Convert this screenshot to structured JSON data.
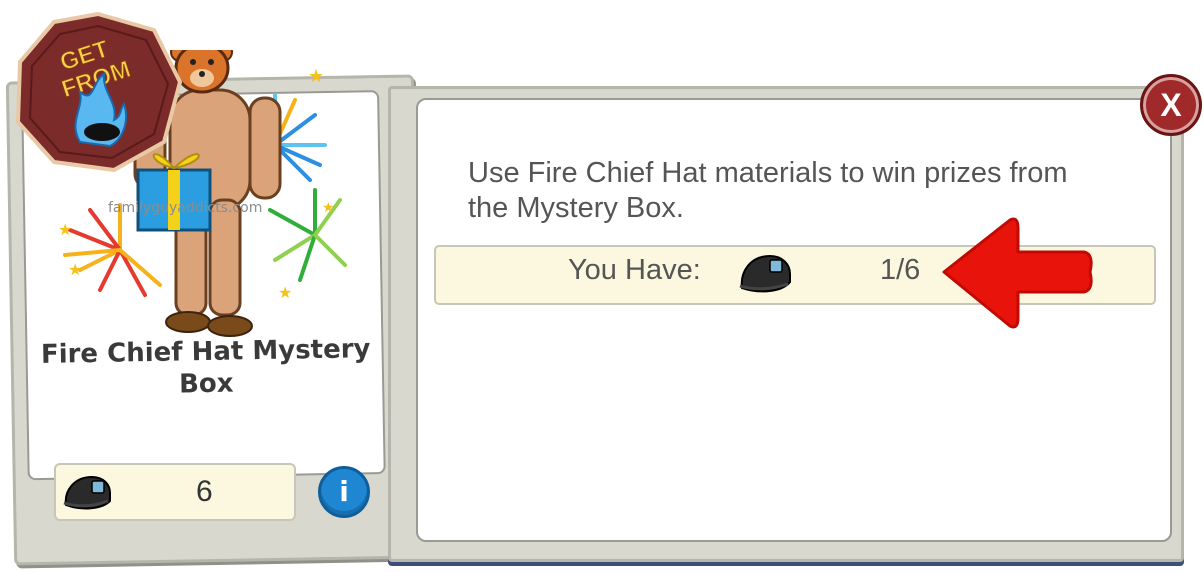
{
  "badge": {
    "text_line1": "GET",
    "text_line2": "FROM"
  },
  "item": {
    "title": "Fire Chief Hat Mystery Box",
    "owned_count": "6",
    "watermark": "familyguyaddicts.com",
    "image_icon": "naked-bear-mask-man-holding-gift-with-fireworks"
  },
  "info_button": {
    "label": "i",
    "icon": "info-icon"
  },
  "close_button": {
    "label": "X",
    "icon": "close-icon"
  },
  "panel": {
    "description": "Use Fire Chief Hat materials to win prizes from the Mystery Box.",
    "you_have_label": "You Have:",
    "you_have_value": "1/6",
    "material_icon": "fire-chief-hat-icon"
  },
  "colors": {
    "frame": "#d8d8cf",
    "info_blue": "#1f86d2",
    "close_red": "#a02a2a",
    "arrow_red": "#e8140c",
    "highlight_bar": "#fbf8df"
  }
}
